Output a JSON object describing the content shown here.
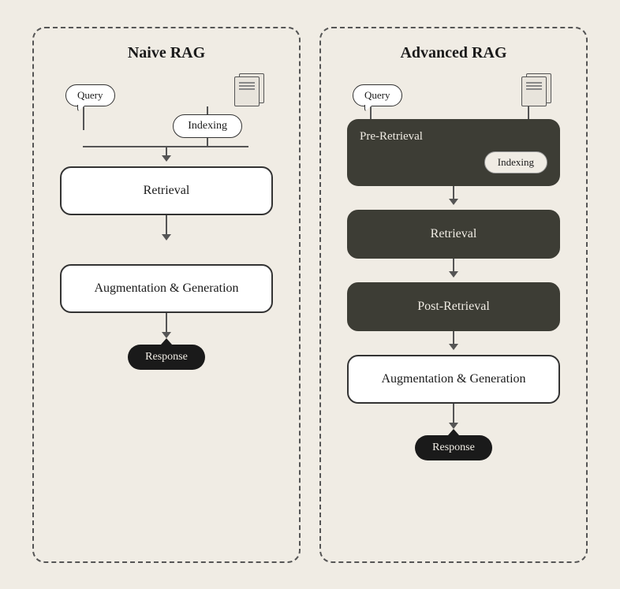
{
  "naive_rag": {
    "title": "Naive RAG",
    "query_label": "Query",
    "docs_label": "Docs",
    "indexing_label": "Indexing",
    "retrieval_label": "Retrieval",
    "aug_gen_label": "Augmentation & Generation",
    "response_label": "Response"
  },
  "advanced_rag": {
    "title": "Advanced RAG",
    "query_label": "Query",
    "docs_label": "Docs",
    "pre_retrieval_label": "Pre-Retrieval",
    "indexing_label": "Indexing",
    "retrieval_label": "Retrieval",
    "post_retrieval_label": "Post-Retrieval",
    "aug_gen_label": "Augmentation & Generation",
    "response_label": "Response"
  },
  "colors": {
    "bg": "#f0ece4",
    "dark_box": "#3d3d35",
    "border": "#555",
    "text_dark": "#1a1a1a",
    "text_light": "#f0ece4"
  }
}
